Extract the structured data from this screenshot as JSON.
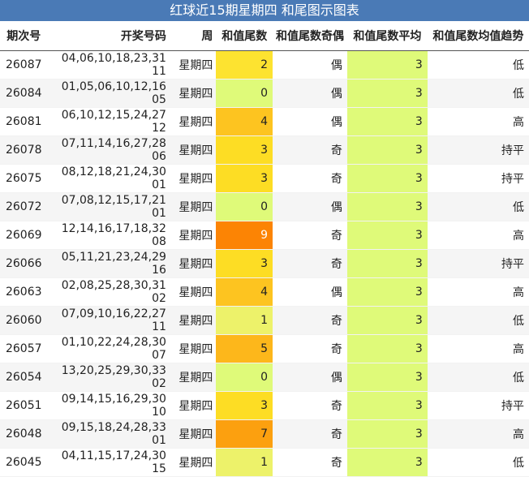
{
  "title": "红球近15期星期四 和尾图示图表",
  "columns": [
    "期次号",
    "开奖号码",
    "周",
    "和值尾数",
    "和值尾数奇偶",
    "和值尾数平均",
    "和值尾数均值趋势"
  ],
  "colors": {
    "header_bg": "#4a7ab6",
    "avg_col": "#dffa79",
    "tail_scale": {
      "0": "#dffa79",
      "1": "#edf26a",
      "2": "#fde330",
      "3": "#fddd24",
      "4": "#fdc420",
      "5": "#fdb71b",
      "7": "#fca00f",
      "9": "#fc8404"
    }
  },
  "chart_data": {
    "type": "table",
    "rows": [
      {
        "issue": "26087",
        "numbers": "04,06,10,18,23,31 11",
        "weekday": "星期四",
        "tail": 2,
        "parity": "偶",
        "avg": 3,
        "trend": "低"
      },
      {
        "issue": "26084",
        "numbers": "01,05,06,10,12,16 05",
        "weekday": "星期四",
        "tail": 0,
        "parity": "偶",
        "avg": 3,
        "trend": "低"
      },
      {
        "issue": "26081",
        "numbers": "06,10,12,15,24,27 12",
        "weekday": "星期四",
        "tail": 4,
        "parity": "偶",
        "avg": 3,
        "trend": "高"
      },
      {
        "issue": "26078",
        "numbers": "07,11,14,16,27,28 06",
        "weekday": "星期四",
        "tail": 3,
        "parity": "奇",
        "avg": 3,
        "trend": "持平"
      },
      {
        "issue": "26075",
        "numbers": "08,12,18,21,24,30 01",
        "weekday": "星期四",
        "tail": 3,
        "parity": "奇",
        "avg": 3,
        "trend": "持平"
      },
      {
        "issue": "26072",
        "numbers": "07,08,12,15,17,21 01",
        "weekday": "星期四",
        "tail": 0,
        "parity": "偶",
        "avg": 3,
        "trend": "低"
      },
      {
        "issue": "26069",
        "numbers": "12,14,16,17,18,32 08",
        "weekday": "星期四",
        "tail": 9,
        "parity": "奇",
        "avg": 3,
        "trend": "高"
      },
      {
        "issue": "26066",
        "numbers": "05,11,21,23,24,29 16",
        "weekday": "星期四",
        "tail": 3,
        "parity": "奇",
        "avg": 3,
        "trend": "持平"
      },
      {
        "issue": "26063",
        "numbers": "02,08,25,28,30,31 02",
        "weekday": "星期四",
        "tail": 4,
        "parity": "偶",
        "avg": 3,
        "trend": "高"
      },
      {
        "issue": "26060",
        "numbers": "07,09,10,16,22,27 11",
        "weekday": "星期四",
        "tail": 1,
        "parity": "奇",
        "avg": 3,
        "trend": "低"
      },
      {
        "issue": "26057",
        "numbers": "01,10,22,24,28,30 07",
        "weekday": "星期四",
        "tail": 5,
        "parity": "奇",
        "avg": 3,
        "trend": "高"
      },
      {
        "issue": "26054",
        "numbers": "13,20,25,29,30,33 02",
        "weekday": "星期四",
        "tail": 0,
        "parity": "偶",
        "avg": 3,
        "trend": "低"
      },
      {
        "issue": "26051",
        "numbers": "09,14,15,16,29,30 10",
        "weekday": "星期四",
        "tail": 3,
        "parity": "奇",
        "avg": 3,
        "trend": "持平"
      },
      {
        "issue": "26048",
        "numbers": "09,15,18,24,28,33 01",
        "weekday": "星期四",
        "tail": 7,
        "parity": "奇",
        "avg": 3,
        "trend": "高"
      },
      {
        "issue": "26045",
        "numbers": "04,11,15,17,24,30 15",
        "weekday": "星期四",
        "tail": 1,
        "parity": "奇",
        "avg": 3,
        "trend": "低"
      }
    ]
  }
}
